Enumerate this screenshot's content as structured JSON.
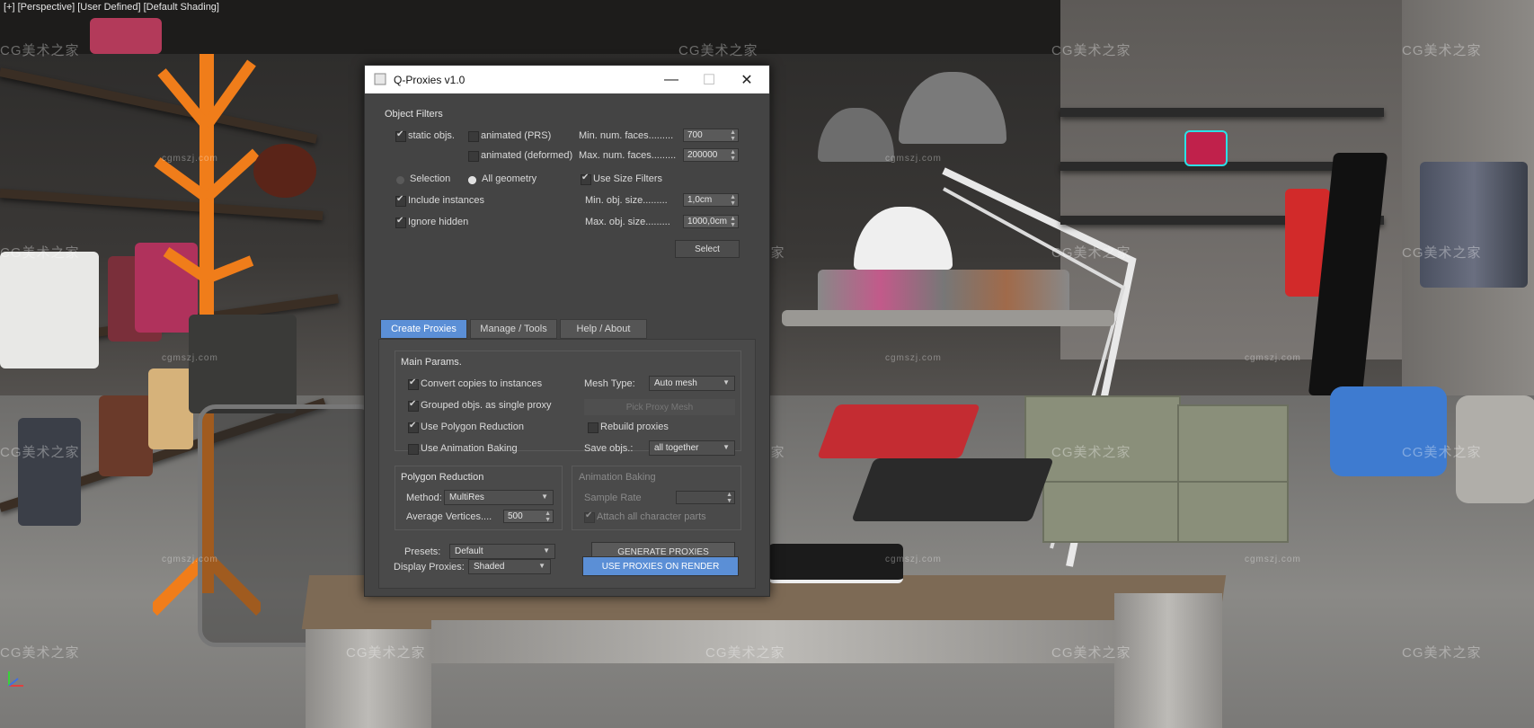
{
  "viewport": {
    "label": "[+] [Perspective] [User Defined] [Default Shading]",
    "watermark": "CG美术之家",
    "watermark_small": "cgmszj.com"
  },
  "dialog": {
    "title": "Q-Proxies v1.0",
    "window_controls": {
      "minimize": "—",
      "maximize": "☐",
      "close": "✕"
    },
    "object_filters": {
      "title": "Object Filters",
      "static_objs": "static objs.",
      "animated_prs": "animated (PRS)",
      "animated_deformed": "animated (deformed)",
      "min_faces_label": "Min. num. faces.........",
      "min_faces_value": "700",
      "max_faces_label": "Max. num. faces.........",
      "max_faces_value": "200000",
      "selection": "Selection",
      "all_geometry": "All geometry",
      "use_size_filters": "Use Size Filters",
      "include_instances": "Include instances",
      "ignore_hidden": "Ignore hidden",
      "min_obj_size_label": "Min. obj. size.........",
      "min_obj_size_value": "1,0cm",
      "max_obj_size_label": "Max. obj. size.........",
      "max_obj_size_value": "1000,0cm",
      "select_button": "Select"
    },
    "tabs": [
      "Create Proxies",
      "Manage / Tools",
      "Help / About"
    ],
    "main_params": {
      "title": "Main Params.",
      "convert_copies": "Convert copies to instances",
      "grouped_objs": "Grouped objs. as single proxy",
      "use_polygon_reduction": "Use Polygon Reduction",
      "use_animation_baking": "Use Animation Baking",
      "mesh_type_label": "Mesh Type:",
      "mesh_type_value": "Auto mesh",
      "pick_proxy_mesh": "Pick Proxy Mesh",
      "rebuild_proxies": "Rebuild proxies",
      "save_objs_label": "Save objs.:",
      "save_objs_value": "all together"
    },
    "polygon_reduction": {
      "title": "Polygon Reduction",
      "method_label": "Method:",
      "method_value": "MultiRes",
      "avg_vertices_label": "Average Vertices....",
      "avg_vertices_value": "500"
    },
    "animation_baking": {
      "title": "Animation Baking",
      "sample_rate": "Sample Rate",
      "attach_all": "Attach all character parts"
    },
    "presets_label": "Presets:",
    "presets_value": "Default",
    "generate_button": "GENERATE PROXIES",
    "display_proxies_label": "Display Proxies:",
    "display_proxies_value": "Shaded",
    "use_proxies_button": "USE PROXIES ON RENDER"
  },
  "colors": {
    "dialog_bg": "#444444",
    "accent_blue": "#5b8fd6",
    "titlebar": "#ffffff"
  }
}
